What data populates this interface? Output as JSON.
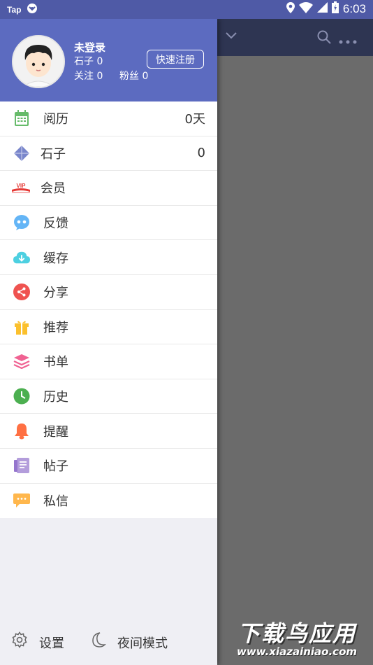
{
  "status_bar": {
    "carrier": "Tap",
    "time": "6:03"
  },
  "profile": {
    "name": "未登录",
    "stones": "石子 0",
    "follow": "关注 0",
    "fans": "粉丝 0",
    "register_label": "快速注册"
  },
  "menu": [
    {
      "label": "阅历",
      "value": "0天",
      "icon": "calendar-icon",
      "color": "#66bb6a"
    },
    {
      "label": "石子",
      "value": "0",
      "icon": "diamond-icon",
      "color": "#7986cb"
    },
    {
      "label": "会员",
      "value": "",
      "icon": "vip-icon",
      "color": "#e53935"
    },
    {
      "label": "反馈",
      "value": "",
      "icon": "feedback-icon",
      "color": "#64b5f6"
    },
    {
      "label": "缓存",
      "value": "",
      "icon": "cloud-download-icon",
      "color": "#4dd0e1"
    },
    {
      "label": "分享",
      "value": "",
      "icon": "share-icon",
      "color": "#ef5350"
    },
    {
      "label": "推荐",
      "value": "",
      "icon": "gift-icon",
      "color": "#fbc02d"
    },
    {
      "label": "书单",
      "value": "",
      "icon": "layers-icon",
      "color": "#f06292"
    },
    {
      "label": "历史",
      "value": "",
      "icon": "clock-icon",
      "color": "#4caf50"
    },
    {
      "label": "提醒",
      "value": "",
      "icon": "bell-icon",
      "color": "#ff7043"
    },
    {
      "label": "帖子",
      "value": "",
      "icon": "post-icon",
      "color": "#b39ddb"
    },
    {
      "label": "私信",
      "value": "",
      "icon": "message-icon",
      "color": "#ffb74d"
    }
  ],
  "bottom": {
    "settings_label": "设置",
    "night_label": "夜间模式"
  },
  "watermark": {
    "title": "下载鸟应用",
    "url": "www.xiazainiao.com"
  }
}
